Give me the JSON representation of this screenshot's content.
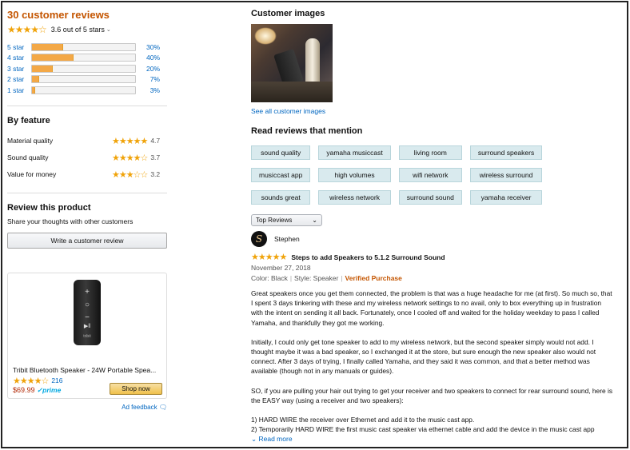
{
  "reviews_summary": {
    "title": "30 customer reviews",
    "rating_text": "3.6 out of 5 stars",
    "stars": "★★★★☆",
    "histogram": [
      {
        "label": "5 star",
        "percent": 30,
        "pct_text": "30%"
      },
      {
        "label": "4 star",
        "percent": 40,
        "pct_text": "40%"
      },
      {
        "label": "3 star",
        "percent": 20,
        "pct_text": "20%"
      },
      {
        "label": "2 star",
        "percent": 7,
        "pct_text": "7%"
      },
      {
        "label": "1 star",
        "percent": 3,
        "pct_text": "3%"
      }
    ]
  },
  "by_feature": {
    "title": "By feature",
    "items": [
      {
        "name": "Material quality",
        "stars": "★★★★★",
        "value": "4.7"
      },
      {
        "name": "Sound quality",
        "stars": "★★★★☆",
        "value": "3.7"
      },
      {
        "name": "Value for money",
        "stars": "★★★☆☆",
        "value": "3.2"
      }
    ]
  },
  "review_product": {
    "title": "Review this product",
    "subtitle": "Share your thoughts with other customers",
    "button": "Write a customer review"
  },
  "ad": {
    "title": "Tribit Bluetooth Speaker - 24W Portable Spea...",
    "stars": "★★★★☆",
    "count": "216",
    "price": "$69.99",
    "prime": "✓prime",
    "button": "Shop now",
    "feedback": "Ad feedback",
    "speaker_label": "tribit"
  },
  "customer_images": {
    "title": "Customer images",
    "see_all": "See all customer images"
  },
  "mentions": {
    "title": "Read reviews that mention",
    "chips": [
      "sound quality",
      "yamaha musiccast",
      "living room",
      "surround speakers",
      "musiccast app",
      "high volumes",
      "wifi network",
      "wireless surround",
      "sounds great",
      "wireless network",
      "surround sound",
      "yamaha receiver"
    ]
  },
  "sort": {
    "selected": "Top Reviews"
  },
  "review": {
    "author": "Stephen",
    "avatar_letter": "S",
    "stars": "★★★★★",
    "title": "Steps to add Speakers to 5.1.2 Surround Sound",
    "date": "November 27, 2018",
    "color": "Color: Black",
    "style": "Style: Speaker",
    "verified": "Verified Purchase",
    "paragraphs": [
      "Great speakers once you get them connected, the problem is that was a huge headache for me (at first). So much so, that I spent 3 days tinkering with these and my wireless network settings to no avail, only to box everything up in frustration with the intent on sending it all back. Fortunately, once I cooled off and waited for the holiday weekday to pass I called Yamaha, and thankfully they got me working.",
      "Initially, I could only get tone speaker to add to my wireless network, but the second speaker simply would not add. I thought maybe it was a bad speaker, so I exchanged it at the store, but sure enough the new speaker also would not connect. After 3 days of trying, I finally called Yamaha, and they said it was common, and that a better method was available (though not in any manuals or guides).",
      "SO, if you are pulling your hair out trying to get your receiver and two speakers to connect for rear surround sound, here is the EASY way (using a receiver and two speakers):",
      "1) HARD WIRE the receiver over Ethernet and add it to the music cast app.",
      "2) Temporarily HARD WIRE the first music cast speaker via ethernet cable and add the device in the music cast app"
    ],
    "read_more": "Read more"
  }
}
